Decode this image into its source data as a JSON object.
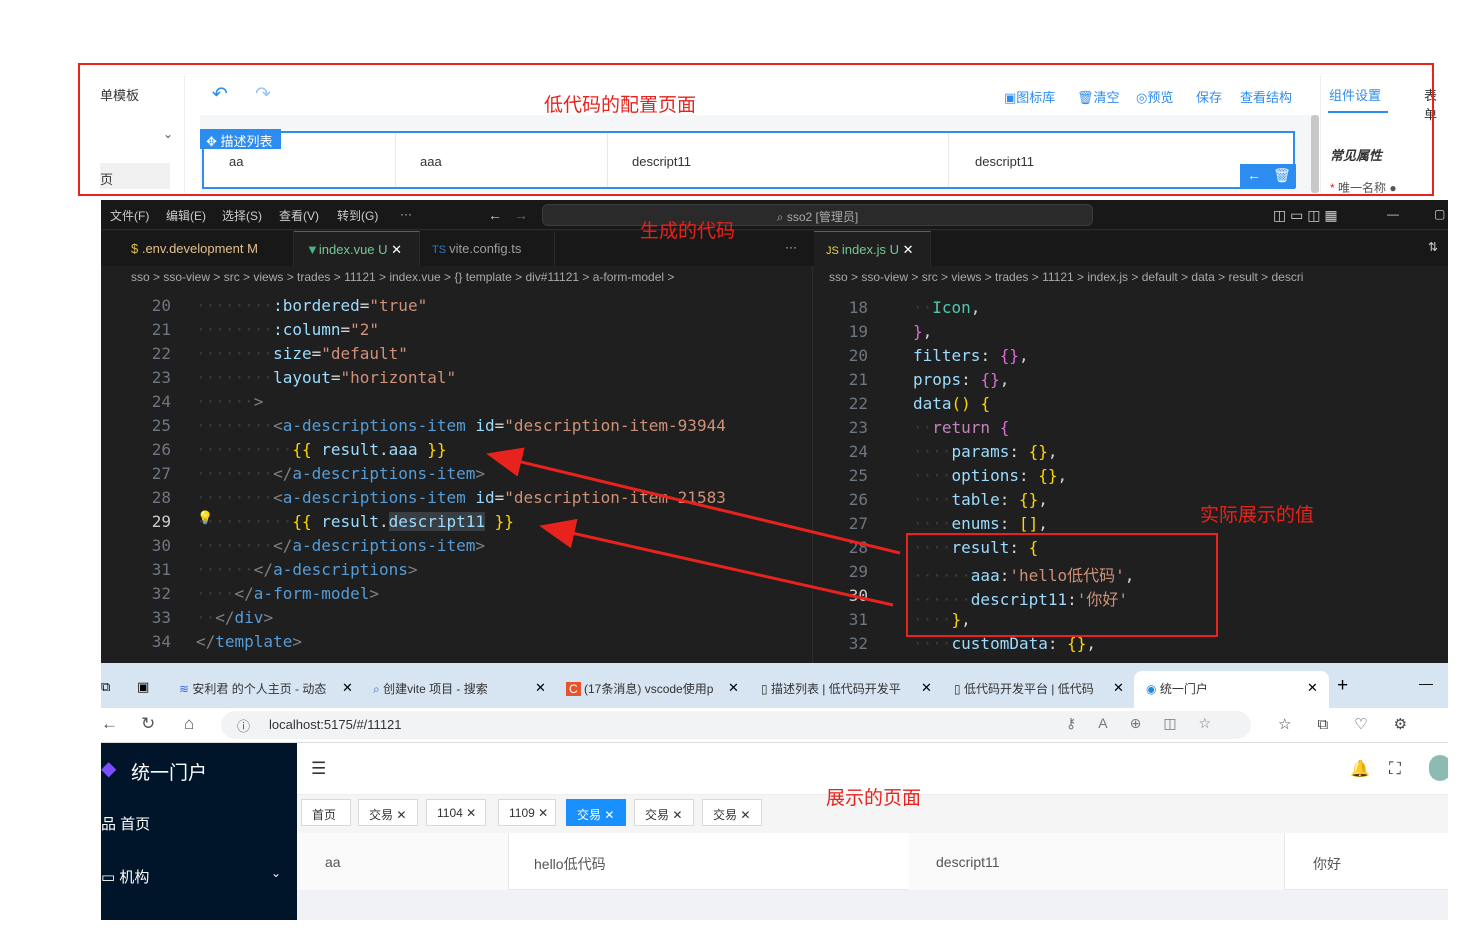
{
  "annotations": {
    "config_page": "低代码的配置页面",
    "generated_code": "生成的代码",
    "actual_value": "实际展示的值",
    "display_page": "展示的页面"
  },
  "config": {
    "left_title": "单模板",
    "left_item": "页",
    "toolbar": {
      "icon_lib": "图标库",
      "clear": "清空",
      "preview": "预览",
      "save": "保存",
      "view_structure": "查看结构"
    },
    "block_tag": "描述列表",
    "cells": [
      "aa",
      "aaa",
      "descript11",
      "descript11"
    ],
    "right_tabs": [
      "组件设置",
      "表单"
    ],
    "right_section": "常见属性",
    "right_field": "唯一名称"
  },
  "vscode": {
    "menus": [
      "文件(F)",
      "编辑(E)",
      "选择(S)",
      "查看(V)",
      "转到(G)",
      "···"
    ],
    "command_center": "sso2 [管理员]",
    "tabs": [
      {
        "label": ".env.development",
        "badge": "M"
      },
      {
        "label": "index.vue",
        "badge": "U"
      },
      {
        "label": "vite.config.ts",
        "badge": ""
      },
      {
        "label": "index.js",
        "badge": "U"
      }
    ],
    "left_breadcrumb": "sso > sso-view > src > views > trades > 11121 > index.vue > {} template > div#11121 > a-form-model >",
    "right_breadcrumb": "sso > sso-view > src > views > trades > 11121 > index.js > default > data > result > descri",
    "left_lines": [
      20,
      21,
      22,
      23,
      24,
      25,
      26,
      27,
      28,
      29,
      30,
      31,
      32,
      33,
      34
    ],
    "right_lines": [
      18,
      19,
      20,
      21,
      22,
      23,
      24,
      25,
      26,
      27,
      28,
      29,
      30,
      31,
      32
    ]
  },
  "browser": {
    "tabs": [
      "安利君 的个人主页 - 动态",
      "创建vite 项目 - 搜索",
      "(17条消息) vscode使用p",
      "描述列表 | 低代码开发平",
      "低代码开发平台 | 低代码",
      "统一门户"
    ],
    "url": "localhost:5175/#/11121",
    "app_title": "统一门户",
    "menu": [
      "首页",
      "机构"
    ],
    "page_tags": [
      "首页",
      "交易",
      "1104",
      "1109",
      "交易",
      "交易",
      "交易"
    ],
    "active_tag_index": 4,
    "row": [
      "aa",
      "hello低代码",
      "descript11",
      "你好"
    ]
  }
}
